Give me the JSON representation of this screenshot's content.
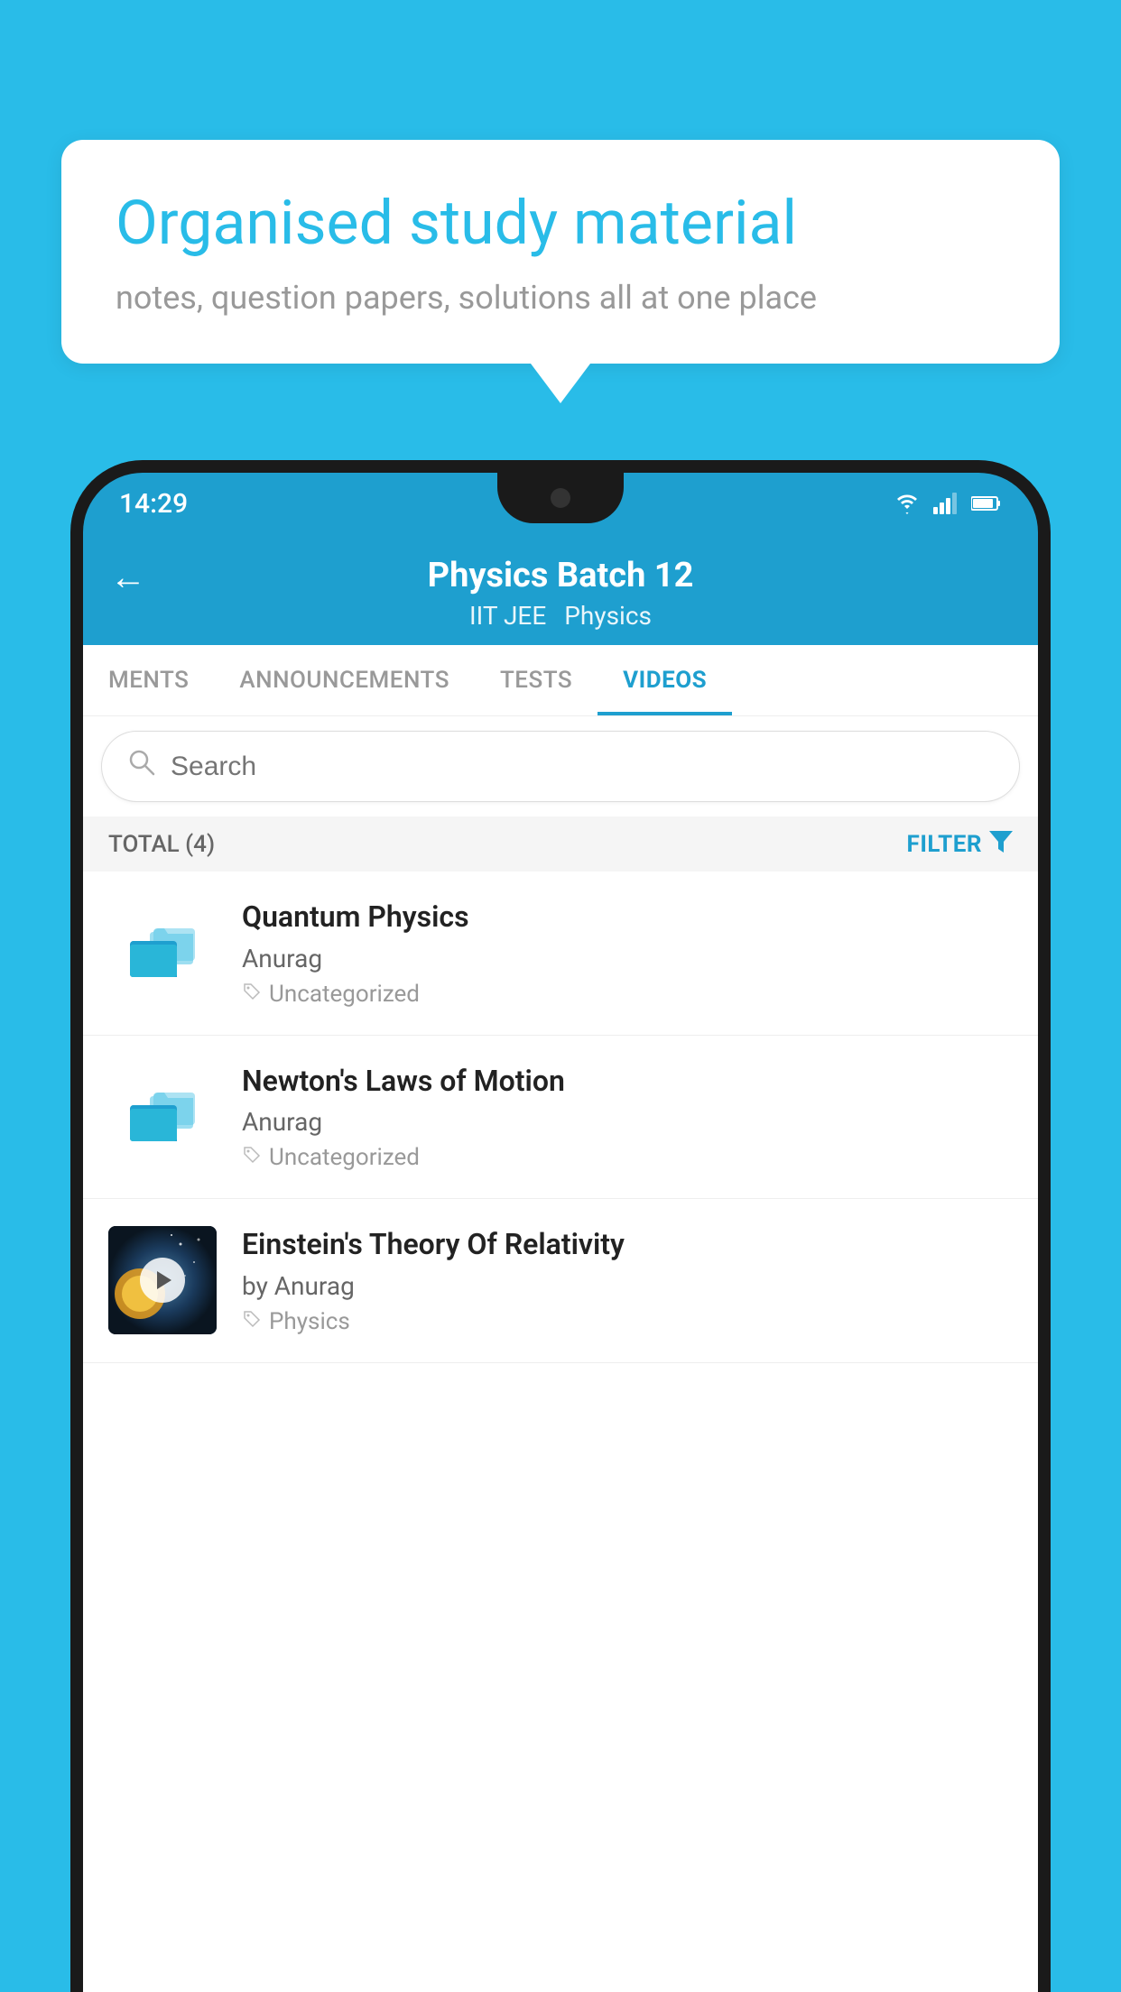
{
  "background_color": "#29bce8",
  "speech_bubble": {
    "title": "Organised study material",
    "subtitle": "notes, question papers, solutions all at one place"
  },
  "phone": {
    "status_bar": {
      "time": "14:29",
      "icons": [
        "wifi",
        "signal",
        "battery"
      ]
    },
    "header": {
      "back_label": "←",
      "title": "Physics Batch 12",
      "tags": [
        "IIT JEE",
        "Physics"
      ]
    },
    "tabs": [
      {
        "label": "MENTS",
        "active": false
      },
      {
        "label": "ANNOUNCEMENTS",
        "active": false
      },
      {
        "label": "TESTS",
        "active": false
      },
      {
        "label": "VIDEOS",
        "active": true
      }
    ],
    "search": {
      "placeholder": "Search"
    },
    "filter_row": {
      "total_label": "TOTAL (4)",
      "filter_label": "FILTER"
    },
    "videos": [
      {
        "title": "Quantum Physics",
        "author": "Anurag",
        "tag": "Uncategorized",
        "type": "folder",
        "thumbnail": null
      },
      {
        "title": "Newton's Laws of Motion",
        "author": "Anurag",
        "tag": "Uncategorized",
        "type": "folder",
        "thumbnail": null
      },
      {
        "title": "Einstein's Theory Of Relativity",
        "author": "by Anurag",
        "tag": "Physics",
        "type": "video",
        "thumbnail": "dark"
      }
    ]
  }
}
